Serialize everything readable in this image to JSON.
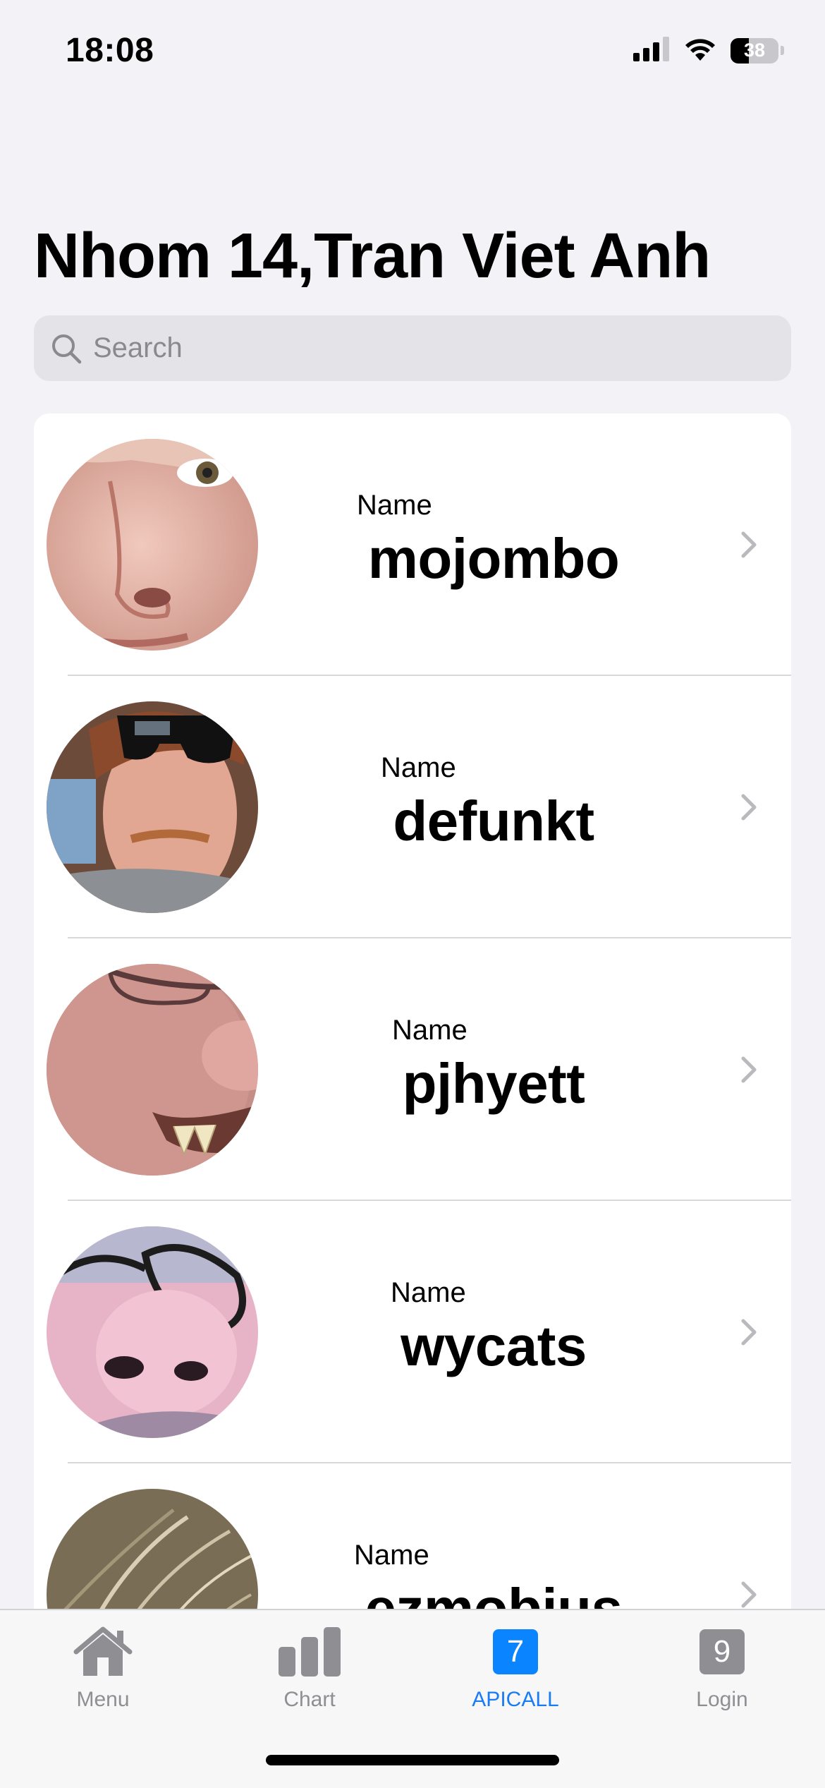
{
  "status_bar": {
    "time": "18:08",
    "battery_level": "38",
    "battery_fraction": 0.38,
    "icons": [
      "signal-icon",
      "wifi-icon",
      "battery-icon"
    ]
  },
  "header": {
    "title": "Nhom 14,Tran Viet Anh"
  },
  "search": {
    "placeholder": "Search",
    "value": ""
  },
  "list": {
    "items": [
      {
        "label": "Name",
        "value": "mojombo"
      },
      {
        "label": "Name",
        "value": "defunkt"
      },
      {
        "label": "Name",
        "value": "pjhyett"
      },
      {
        "label": "Name",
        "value": "wycats"
      },
      {
        "label": "Name",
        "value": "ezmobius"
      }
    ]
  },
  "tab_bar": {
    "tabs": [
      {
        "label": "Menu",
        "icon": "house-icon",
        "active": false
      },
      {
        "label": "Chart",
        "icon": "bar-chart-icon",
        "active": false
      },
      {
        "label": "APICALL",
        "icon": "number-7-icon",
        "badge": "7",
        "active": true
      },
      {
        "label": "Login",
        "icon": "number-9-icon",
        "badge": "9",
        "active": false
      }
    ]
  },
  "colors": {
    "accent": "#0a84ff",
    "background": "#f2f2f7",
    "inactive_tab": "#8e8e93"
  }
}
